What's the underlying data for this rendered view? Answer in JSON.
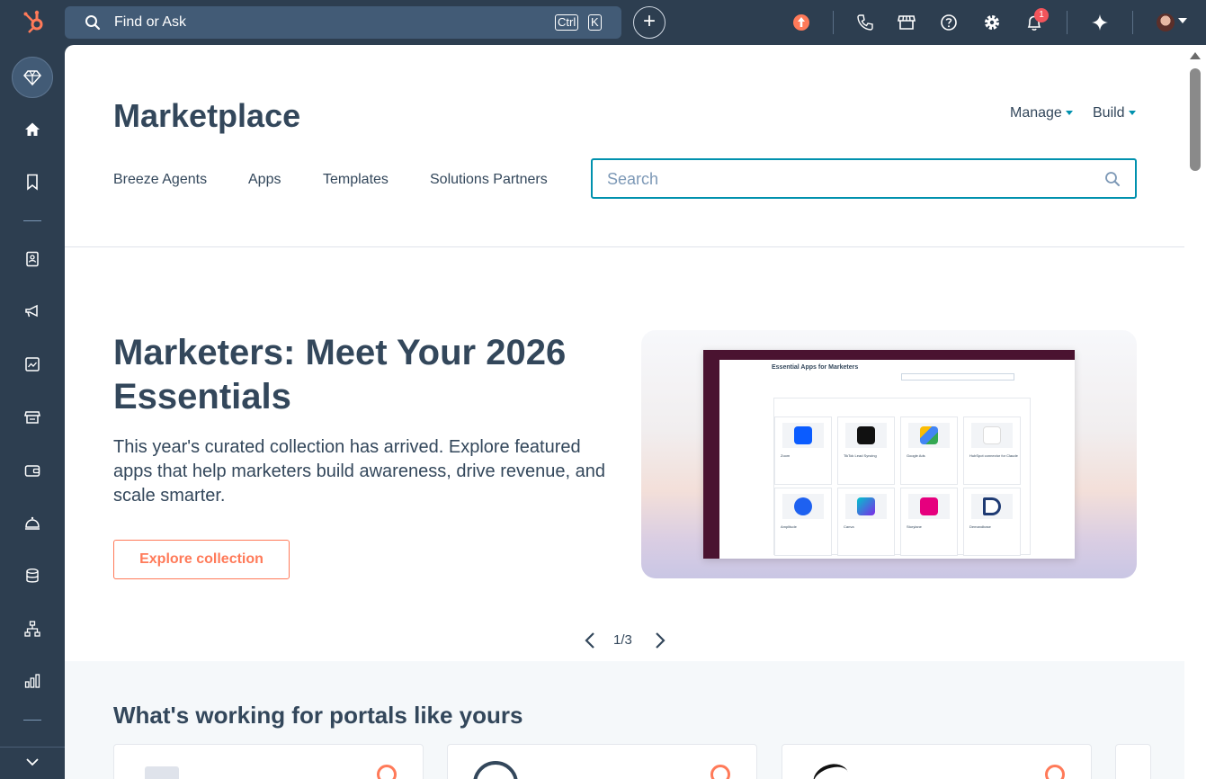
{
  "topbar": {
    "search_label": "Find or Ask",
    "kbd_ctrl": "Ctrl",
    "kbd_k": "K",
    "notification_count": "1"
  },
  "colors": {
    "topbar_bg": "#2d3e50",
    "accent": "#ff7a59",
    "teal": "#0091ae",
    "text": "#33475b"
  },
  "icons": {
    "logo": "hubspot-logo",
    "topbar": [
      "upgrade-icon",
      "phone-icon",
      "marketplace-icon",
      "help-icon",
      "settings-icon",
      "notifications-icon",
      "ai-sparkle-icon"
    ],
    "leftnav": [
      "diamond-icon",
      "home-icon",
      "bookmark-icon",
      "contacts-icon",
      "marketing-icon",
      "content-icon",
      "commerce-icon",
      "wallet-icon",
      "service-icon",
      "data-icon",
      "automation-icon",
      "reporting-icon",
      "chevron-down-icon"
    ]
  },
  "header": {
    "title": "Marketplace",
    "manage_label": "Manage",
    "build_label": "Build",
    "tabs": [
      {
        "label": "Breeze Agents"
      },
      {
        "label": "Apps"
      },
      {
        "label": "Templates"
      },
      {
        "label": "Solutions Partners"
      }
    ],
    "search_placeholder": "Search"
  },
  "hero": {
    "title": "Marketers: Meet Your 2026 Essentials",
    "description": "This year's curated collection has arrived. Explore featured apps that help marketers build awareness, drive revenue, and scale smarter.",
    "cta": "Explore collection",
    "image_title": "Essential Apps for Marketers",
    "image_apps": [
      "Zoom",
      "TikTok Lead Syncing",
      "Google Ads",
      "HubSpot connector for Claude",
      "Amplitude",
      "Canva",
      "Storylane",
      "Demandbase"
    ]
  },
  "pager": {
    "label": "1/3"
  },
  "lower": {
    "title": "What's working for portals like yours"
  }
}
